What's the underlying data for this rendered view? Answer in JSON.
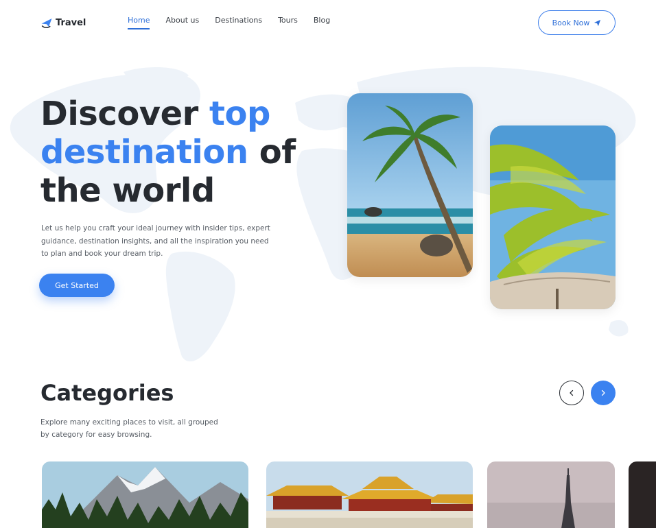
{
  "header": {
    "logo_text": "Travel",
    "nav": [
      {
        "label": "Home",
        "active": true
      },
      {
        "label": "About us",
        "active": false
      },
      {
        "label": "Destinations",
        "active": false
      },
      {
        "label": "Tours",
        "active": false
      },
      {
        "label": "Blog",
        "active": false
      }
    ],
    "book_label": "Book Now"
  },
  "hero": {
    "title_line1_a": "Discover ",
    "title_line1_b": "top",
    "title_line2_a": "destination",
    "title_line2_b": " of",
    "title_line3": "the world",
    "subtitle": "Let us help you craft your ideal journey with insider tips, expert guidance, destination insights, and all the inspiration you need to plan and book your dream trip.",
    "cta_label": "Get Started"
  },
  "categories": {
    "title": "Categories",
    "subtitle": "Explore many exciting places to visit, all grouped by category for easy browsing."
  },
  "colors": {
    "accent": "#3b82f0",
    "text_dark": "#262a30",
    "map": "#eef3f9"
  },
  "icons": [
    "plane-logo-icon",
    "paper-plane-icon",
    "chevron-left-icon",
    "chevron-right-icon"
  ]
}
